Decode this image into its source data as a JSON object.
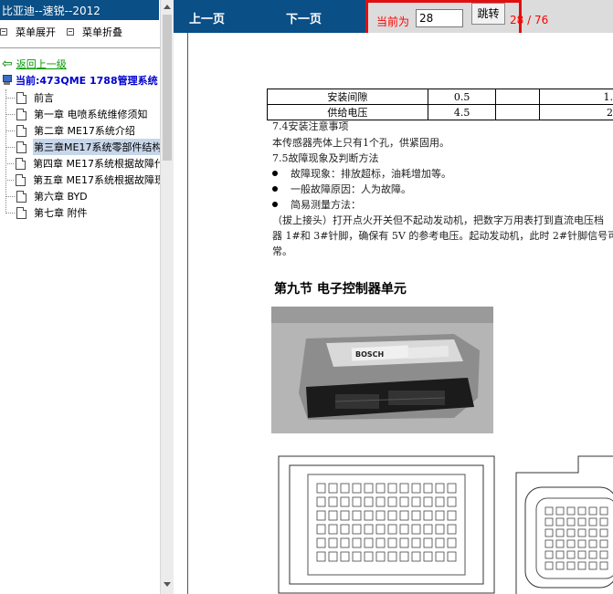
{
  "left": {
    "title": "比亚迪--速锐--2012",
    "menu_expand": "菜单展开",
    "menu_collapse": "菜单折叠",
    "back_label": "返回上一级",
    "current_label": "当前:473QME 1788管理系统",
    "tree": [
      {
        "label": "前言",
        "selected": false
      },
      {
        "label": "第一章 电喷系统维修须知",
        "selected": false
      },
      {
        "label": "第二章 ME17系统介绍",
        "selected": false
      },
      {
        "label": "第三章ME17系统零部件结构",
        "selected": true
      },
      {
        "label": "第四章 ME17系统根据故障代",
        "selected": false
      },
      {
        "label": "第五章 ME17系统根据故障现",
        "selected": false
      },
      {
        "label": "第六章 BYD",
        "selected": false
      },
      {
        "label": "第七章 附件",
        "selected": false
      }
    ]
  },
  "toolbar": {
    "prev_label": "上一页",
    "next_label": "下一页",
    "current_prefix": "当前为",
    "page_value": "28",
    "go_label": "跳转",
    "page_count": "28 / 76"
  },
  "document": {
    "table_rows": [
      {
        "name": "安装间隙",
        "v1": "0.5",
        "v2": "1."
      },
      {
        "name": "供给电压",
        "v1": "4.5",
        "v2": "2"
      }
    ],
    "p_74": "7.4安装注意事项",
    "p_74_body": "本传感器壳体上只有1个孔，供紧固用。",
    "p_75": "7.5故障现象及判断方法",
    "bullets": [
      "故障现象：排放超标，油耗增加等。",
      "一般故障原因：人为故障。",
      "简易测量方法："
    ],
    "method_line1": "（拔上接头）打开点火开关但不起动发动机，把数字万用表打到直流电压档",
    "method_line2": "器 1#和 3#针脚，确保有 5V 的参考电压。起动发动机，此时 2#针脚信号可",
    "method_line3": "常。",
    "section_title": "第九节  电子控制器单元",
    "ecu_label": "BOSCH"
  },
  "colors": {
    "titlebar": "#0a4f86",
    "accent_red": "#ff0000",
    "link_green": "#009900",
    "current_blue": "#0000cc"
  }
}
